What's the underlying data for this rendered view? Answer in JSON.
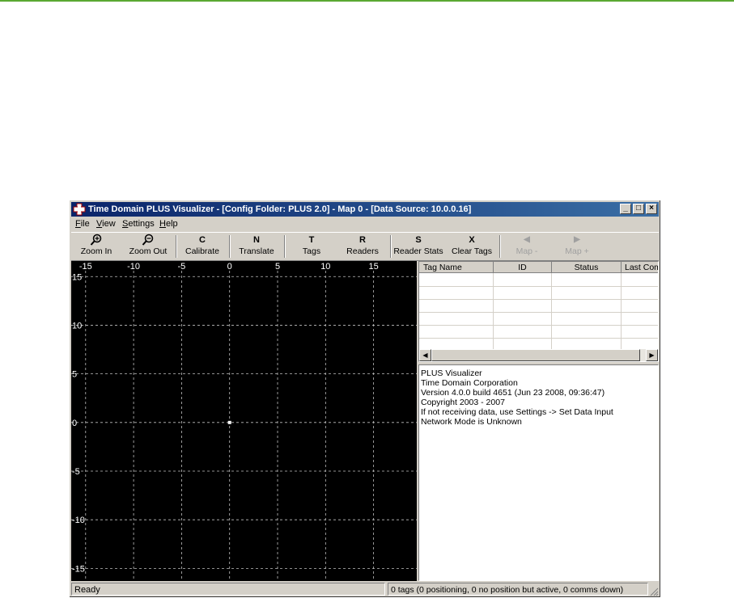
{
  "window": {
    "title": "Time Domain PLUS Visualizer - [Config Folder: PLUS 2.0] - Map 0 - [Data Source:  10.0.0.16]",
    "controls": {
      "minimize": "_",
      "maximize": "□",
      "close": "×"
    }
  },
  "menu": [
    {
      "accel": "F",
      "rest": "ile"
    },
    {
      "accel": "V",
      "rest": "iew"
    },
    {
      "accel": "S",
      "rest": "ettings"
    },
    {
      "accel": "H",
      "rest": "elp"
    }
  ],
  "toolbar": {
    "zoom_in": {
      "glyph": "zoom-in-icon",
      "label": "Zoom In"
    },
    "zoom_out": {
      "glyph": "zoom-out-icon",
      "label": "Zoom Out"
    },
    "calibrate": {
      "glyph": "C",
      "label": "Calibrate"
    },
    "translate": {
      "glyph": "N",
      "label": "Translate"
    },
    "tags": {
      "glyph": "T",
      "label": "Tags"
    },
    "readers": {
      "glyph": "R",
      "label": "Readers"
    },
    "reader_stats": {
      "glyph": "S",
      "label": "Reader Stats"
    },
    "clear_tags": {
      "glyph": "X",
      "label": "Clear Tags"
    },
    "map_minus": {
      "glyph": "◀",
      "label": "Map -"
    },
    "map_plus": {
      "glyph": "▶",
      "label": "Map +"
    }
  },
  "plot": {
    "x_ticks": [
      "-15",
      "-10",
      "-5",
      "0",
      "5",
      "10",
      "15"
    ],
    "y_ticks": [
      "15",
      "10",
      "5",
      "0",
      "-5",
      "-10",
      "-15"
    ],
    "x_values": [
      -15,
      -10,
      -5,
      0,
      5,
      10,
      15
    ],
    "y_values": [
      15,
      10,
      5,
      0,
      -5,
      -10,
      -15
    ],
    "xlim": [
      -16.5,
      19.5
    ],
    "ylim": [
      -16.3,
      16.6
    ],
    "origin_marker": {
      "x": 0,
      "y": 0
    },
    "background": "#000000",
    "grid_color": "#c0c0c0"
  },
  "tags_table": {
    "columns": [
      "Tag Name",
      "ID",
      "Status",
      "Last Comm"
    ],
    "rows": []
  },
  "log": [
    "PLUS Visualizer",
    "Time Domain Corporation",
    "Version 4.0.0 build 4651 (Jun 23 2008, 09:36:47)",
    "Copyright 2003 - 2007",
    "If not receiving data, use Settings -> Set Data Input",
    "Network Mode is Unknown"
  ],
  "status": {
    "left": "Ready",
    "right": "0 tags (0 positioning, 0 no position but active, 0 comms down)"
  },
  "colors": {
    "title_start": "#0a246a",
    "title_end": "#3a6ea5",
    "accent_rule": "#5aa832"
  }
}
